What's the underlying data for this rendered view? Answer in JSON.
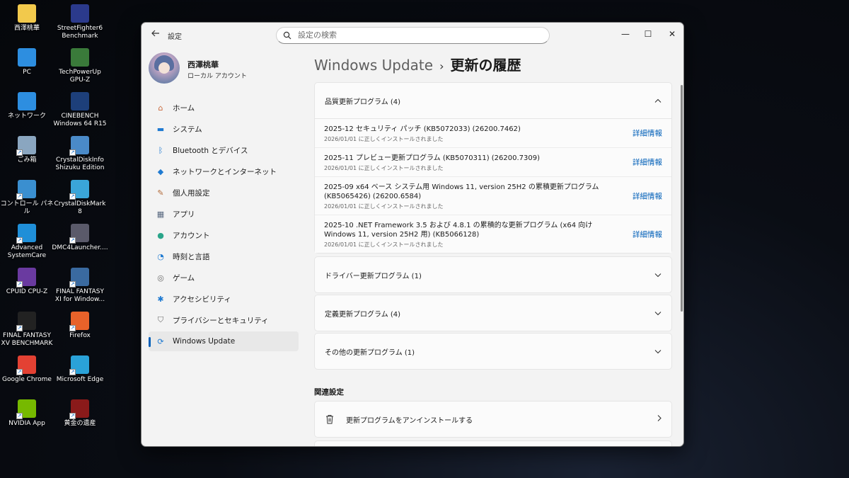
{
  "desktop": {
    "icons": [
      {
        "label": "西澤桃華",
        "icon": "folder-icon",
        "color": "#f2c94c"
      },
      {
        "label": "StreetFighter6 Benchmark",
        "icon": "sf6-icon",
        "color": "#2b3a8c"
      },
      {
        "label": "PC",
        "icon": "monitor-icon",
        "color": "#2d8ee0"
      },
      {
        "label": "TechPowerUp GPU-Z",
        "icon": "gpuz-icon",
        "color": "#3a7a3a"
      },
      {
        "label": "ネットワーク",
        "icon": "network-icon",
        "color": "#2d8ee0"
      },
      {
        "label": "CINEBENCH Windows 64 R15",
        "icon": "cinebench-icon",
        "color": "#1d3f7a"
      },
      {
        "label": "ごみ箱",
        "icon": "recycle-bin-icon",
        "color": "#8aa6c0"
      },
      {
        "label": "CrystalDiskInfo Shizuku Edition",
        "icon": "crystaldiskinfo-icon",
        "color": "#4a8ac8"
      },
      {
        "label": "コントロール パネル",
        "icon": "control-panel-icon",
        "color": "#3a8fd0"
      },
      {
        "label": "CrystalDiskMark 8",
        "icon": "crystaldiskmark-icon",
        "color": "#3aa5d8"
      },
      {
        "label": "Advanced SystemCare",
        "icon": "advanced-systemcare-icon",
        "color": "#1f8fd8"
      },
      {
        "label": "DMC4Launcher....",
        "icon": "dmc4-icon",
        "color": "#5a5a6a"
      },
      {
        "label": "CPUID CPU-Z",
        "icon": "cpuz-icon",
        "color": "#6a3aa0"
      },
      {
        "label": "FINAL FANTASY XI for Window...",
        "icon": "ffxi-icon",
        "color": "#3a6aa0"
      },
      {
        "label": "FINAL FANTASY XV BENCHMARK",
        "icon": "ffxv-icon",
        "color": "#222222"
      },
      {
        "label": "Firefox",
        "icon": "firefox-icon",
        "color": "#e8622a"
      },
      {
        "label": "Google Chrome",
        "icon": "chrome-icon",
        "color": "#e34133"
      },
      {
        "label": "Microsoft Edge",
        "icon": "edge-icon",
        "color": "#2aa2d8"
      },
      {
        "label": "NVIDIA App",
        "icon": "nvidia-icon",
        "color": "#76b900"
      },
      {
        "label": "黄金の遺産",
        "icon": "golden-legacy-icon",
        "color": "#8a1a1a"
      }
    ]
  },
  "window": {
    "app_title": "設定",
    "search_placeholder": "設定の検索",
    "controls": {
      "minimize": "—",
      "maximize": "☐",
      "close": "✕"
    }
  },
  "profile": {
    "name": "西澤桃華",
    "type": "ローカル アカウント"
  },
  "sidebar": {
    "items": [
      {
        "label": "ホーム",
        "icon": "home-icon",
        "glyph": "⌂",
        "color": "#c9673a"
      },
      {
        "label": "システム",
        "icon": "system-icon",
        "glyph": "▬",
        "color": "#1f7ad1"
      },
      {
        "label": "Bluetooth とデバイス",
        "icon": "bluetooth-icon",
        "glyph": "ᛒ",
        "color": "#1f7ad1"
      },
      {
        "label": "ネットワークとインターネット",
        "icon": "wifi-icon",
        "glyph": "◆",
        "color": "#1f7ad1"
      },
      {
        "label": "個人用設定",
        "icon": "brush-icon",
        "glyph": "✎",
        "color": "#b26a3a"
      },
      {
        "label": "アプリ",
        "icon": "apps-icon",
        "glyph": "▦",
        "color": "#5a6a80"
      },
      {
        "label": "アカウント",
        "icon": "account-icon",
        "glyph": "●",
        "color": "#2aa58a"
      },
      {
        "label": "時刻と言語",
        "icon": "time-language-icon",
        "glyph": "◔",
        "color": "#1f7ad1"
      },
      {
        "label": "ゲーム",
        "icon": "gaming-icon",
        "glyph": "◎",
        "color": "#6a6a6a"
      },
      {
        "label": "アクセシビリティ",
        "icon": "accessibility-icon",
        "glyph": "✱",
        "color": "#1f7ad1"
      },
      {
        "label": "プライバシーとセキュリティ",
        "icon": "shield-icon",
        "glyph": "⛉",
        "color": "#6a6a6a"
      },
      {
        "label": "Windows Update",
        "icon": "windows-update-icon",
        "glyph": "⟳",
        "color": "#1f7ad1",
        "active": true
      }
    ]
  },
  "main": {
    "breadcrumb_parent": "Windows Update",
    "breadcrumb_separator": "›",
    "breadcrumb_current": "更新の履歴",
    "quality": {
      "title": "品質更新プログラム (4)",
      "updates": [
        {
          "title": "2025-12 セキュリティ パッチ (KB5072033) (26200.7462)",
          "status": "2026/01/01 に正しくインストールされました",
          "link": "詳細情報"
        },
        {
          "title": "2025-11 プレビュー更新プログラム (KB5070311) (26200.7309)",
          "status": "2026/01/01 に正しくインストールされました",
          "link": "詳細情報"
        },
        {
          "title": "2025-09 x64 ベース システム用 Windows 11, version 25H2 の累積更新プログラム (KB5065426) (26200.6584)",
          "status": "2026/01/01 に正しくインストールされました",
          "link": "詳細情報"
        },
        {
          "title": "2025-10 .NET Framework 3.5 および 4.8.1 の累積的な更新プログラム (x64 向け Windows 11, version 25H2 用) (KB5066128)",
          "status": "2026/01/01 に正しくインストールされました",
          "link": "詳細情報"
        }
      ]
    },
    "sections": [
      {
        "title": "ドライバー更新プログラム (1)"
      },
      {
        "title": "定義更新プログラム (4)"
      },
      {
        "title": "その他の更新プログラム (1)"
      }
    ],
    "related_label": "関連設定",
    "uninstall_label": "更新プログラムをアンインストールする"
  }
}
